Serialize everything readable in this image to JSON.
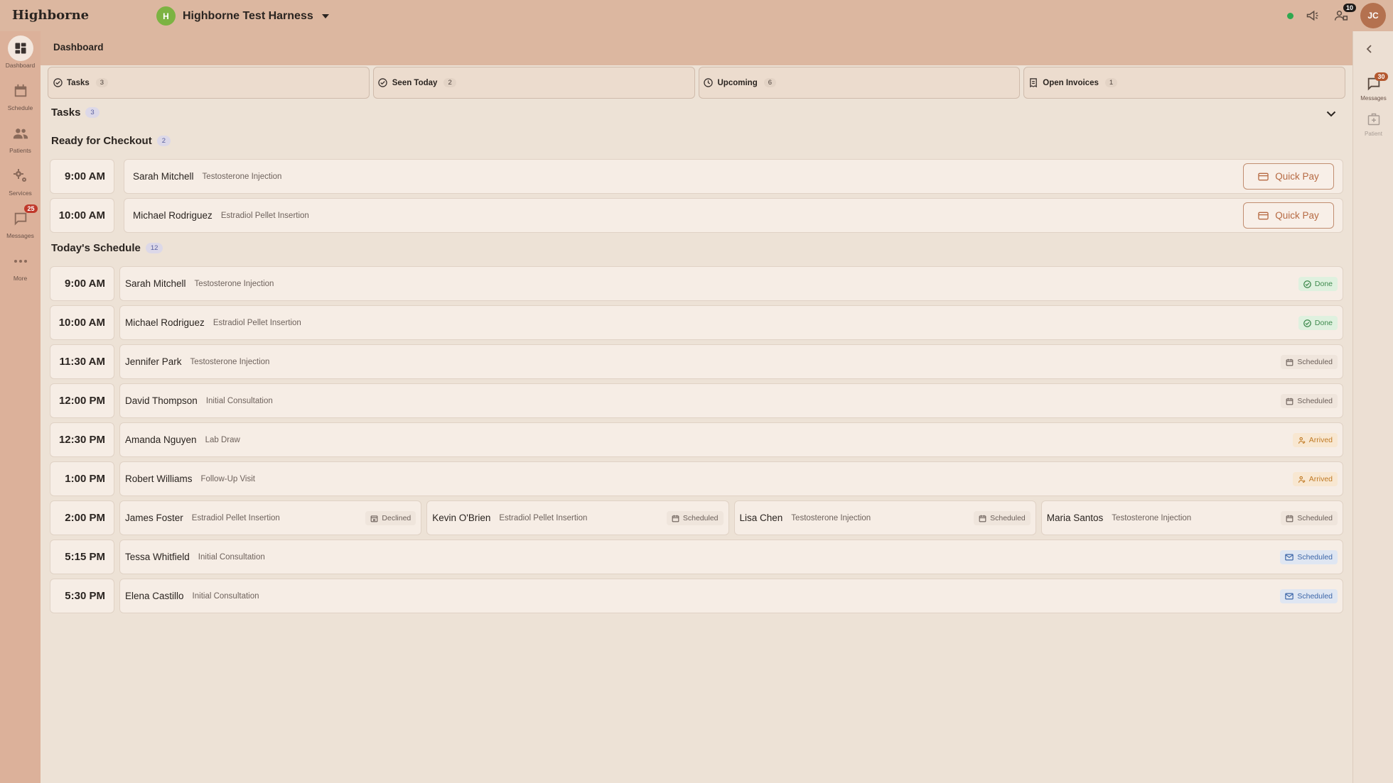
{
  "app": {
    "brand": "Highborne",
    "practice_initial": "H",
    "practice_name": "Highborne Test Harness",
    "alerts_count": "10",
    "user_initials": "JC"
  },
  "sidebar": {
    "items": [
      {
        "label": "Dashboard",
        "icon": "dashboard-icon",
        "active": true
      },
      {
        "label": "Schedule",
        "icon": "calendar-icon"
      },
      {
        "label": "Patients",
        "icon": "people-icon"
      },
      {
        "label": "Services",
        "icon": "gears-icon"
      },
      {
        "label": "Messages",
        "icon": "chat-icon",
        "badge": "25"
      },
      {
        "label": "More",
        "icon": "more-dots-icon"
      }
    ]
  },
  "right_rail": {
    "messages_label": "Messages",
    "messages_badge": "30",
    "patient_label": "Patient"
  },
  "page": {
    "title": "Dashboard"
  },
  "stat_tabs": [
    {
      "label": "Tasks",
      "count": "3",
      "icon": "check-circle-icon"
    },
    {
      "label": "Seen Today",
      "count": "2",
      "icon": "check-circle-icon"
    },
    {
      "label": "Upcoming",
      "count": "6",
      "icon": "clock-icon"
    },
    {
      "label": "Open Invoices",
      "count": "1",
      "icon": "invoice-icon"
    }
  ],
  "tasks": {
    "title": "Tasks",
    "count": "3",
    "ready_title": "Ready for Checkout",
    "ready_count": "2",
    "quick_pay_label": "Quick Pay",
    "checkout": [
      {
        "time": "9:00 AM",
        "name": "Sarah Mitchell",
        "service": "Testosterone Injection"
      },
      {
        "time": "10:00 AM",
        "name": "Michael Rodriguez",
        "service": "Estradiol Pellet Insertion"
      }
    ]
  },
  "schedule": {
    "title": "Today's Schedule",
    "count": "12",
    "rows": [
      {
        "time": "9:00 AM",
        "appts": [
          {
            "name": "Sarah Mitchell",
            "service": "Testosterone Injection",
            "status": "Done",
            "kind": "done"
          }
        ]
      },
      {
        "time": "10:00 AM",
        "appts": [
          {
            "name": "Michael Rodriguez",
            "service": "Estradiol Pellet Insertion",
            "status": "Done",
            "kind": "done"
          }
        ]
      },
      {
        "time": "11:30 AM",
        "appts": [
          {
            "name": "Jennifer Park",
            "service": "Testosterone Injection",
            "status": "Scheduled",
            "kind": "scheduled"
          }
        ]
      },
      {
        "time": "12:00 PM",
        "appts": [
          {
            "name": "David Thompson",
            "service": "Initial Consultation",
            "status": "Scheduled",
            "kind": "scheduled"
          }
        ]
      },
      {
        "time": "12:30 PM",
        "appts": [
          {
            "name": "Amanda Nguyen",
            "service": "Lab Draw",
            "status": "Arrived",
            "kind": "arrived"
          }
        ]
      },
      {
        "time": "1:00 PM",
        "appts": [
          {
            "name": "Robert Williams",
            "service": "Follow-Up Visit",
            "status": "Arrived",
            "kind": "arrived"
          }
        ]
      },
      {
        "time": "2:00 PM",
        "appts": [
          {
            "name": "James Foster",
            "service": "Estradiol Pellet Insertion",
            "status": "Declined",
            "kind": "declined"
          },
          {
            "name": "Kevin O'Brien",
            "service": "Estradiol Pellet Insertion",
            "status": "Scheduled",
            "kind": "scheduled"
          },
          {
            "name": "Lisa Chen",
            "service": "Testosterone Injection",
            "status": "Scheduled",
            "kind": "scheduled"
          },
          {
            "name": "Maria Santos",
            "service": "Testosterone Injection",
            "status": "Scheduled",
            "kind": "scheduled"
          }
        ]
      },
      {
        "time": "5:15 PM",
        "appts": [
          {
            "name": "Tessa Whitfield",
            "service": "Initial Consultation",
            "status": "Scheduled",
            "kind": "email"
          }
        ]
      },
      {
        "time": "5:30 PM",
        "appts": [
          {
            "name": "Elena Castillo",
            "service": "Initial Consultation",
            "status": "Scheduled",
            "kind": "email"
          }
        ]
      }
    ]
  }
}
